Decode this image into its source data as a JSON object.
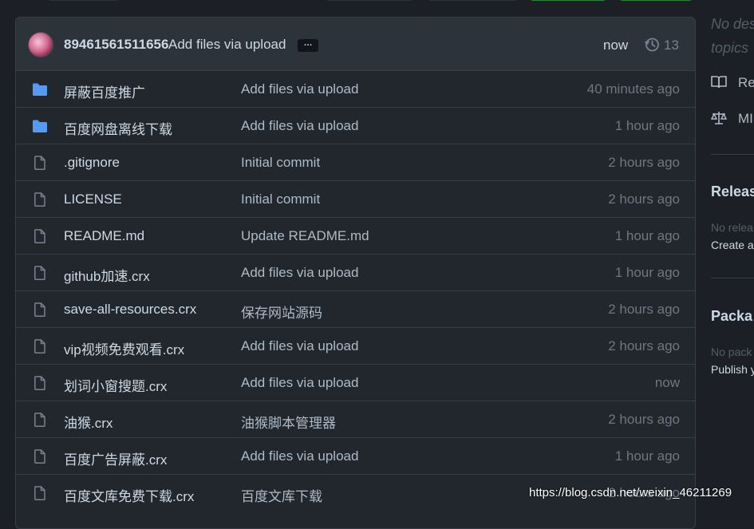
{
  "commit": {
    "user": "89461561511656",
    "message": "Add files via upload",
    "ellipsis": "…",
    "time": "now",
    "history_count": "13"
  },
  "files": [
    {
      "name": "屏蔽百度推广",
      "type": "folder",
      "message": "Add files via upload",
      "age": "40 minutes ago"
    },
    {
      "name": "百度网盘离线下载",
      "type": "folder",
      "message": "Add files via upload",
      "age": "1 hour ago"
    },
    {
      "name": ".gitignore",
      "type": "file",
      "message": "Initial commit",
      "age": "2 hours ago"
    },
    {
      "name": "LICENSE",
      "type": "file",
      "message": "Initial commit",
      "age": "2 hours ago"
    },
    {
      "name": "README.md",
      "type": "file",
      "message": "Update README.md",
      "age": "1 hour ago"
    },
    {
      "name": "github加速.crx",
      "type": "file",
      "message": "Add files via upload",
      "age": "1 hour ago"
    },
    {
      "name": "save-all-resources.crx",
      "type": "file",
      "message": "保存网站源码",
      "age": "2 hours ago"
    },
    {
      "name": "vip视频免费观看.crx",
      "type": "file",
      "message": "Add files via upload",
      "age": "2 hours ago"
    },
    {
      "name": "划词小窗搜题.crx",
      "type": "file",
      "message": "Add files via upload",
      "age": "now"
    },
    {
      "name": "油猴.crx",
      "type": "file",
      "message": "油猴脚本管理器",
      "age": "2 hours ago"
    },
    {
      "name": "百度广告屏蔽.crx",
      "type": "file",
      "message": "Add files via upload",
      "age": "1 hour ago"
    },
    {
      "name": "百度文库免费下载.crx",
      "type": "file",
      "message": "百度文库下载",
      "age": "2 hours ago"
    }
  ],
  "sidebar": {
    "desc_line1": "No des",
    "desc_line2": "topics",
    "readme_label": "Re",
    "license_label": "MI",
    "releases_heading": "Releas",
    "releases_none": "No relea",
    "releases_create": "Create a",
    "packages_heading": "Packa",
    "packages_none": "No pack",
    "packages_publish": "Publish y"
  },
  "watermark": "https://blog.csdn.net/weixin_46211269",
  "icons": {
    "folder": "folder-icon",
    "file": "file-icon",
    "history": "history-icon",
    "book": "book-icon",
    "law": "law-icon"
  },
  "colors": {
    "background": "#1c2026",
    "box": "#22272e",
    "header": "#2d333b",
    "folder": "#539bf5",
    "file_icon": "#768390",
    "border": "#373e47"
  }
}
